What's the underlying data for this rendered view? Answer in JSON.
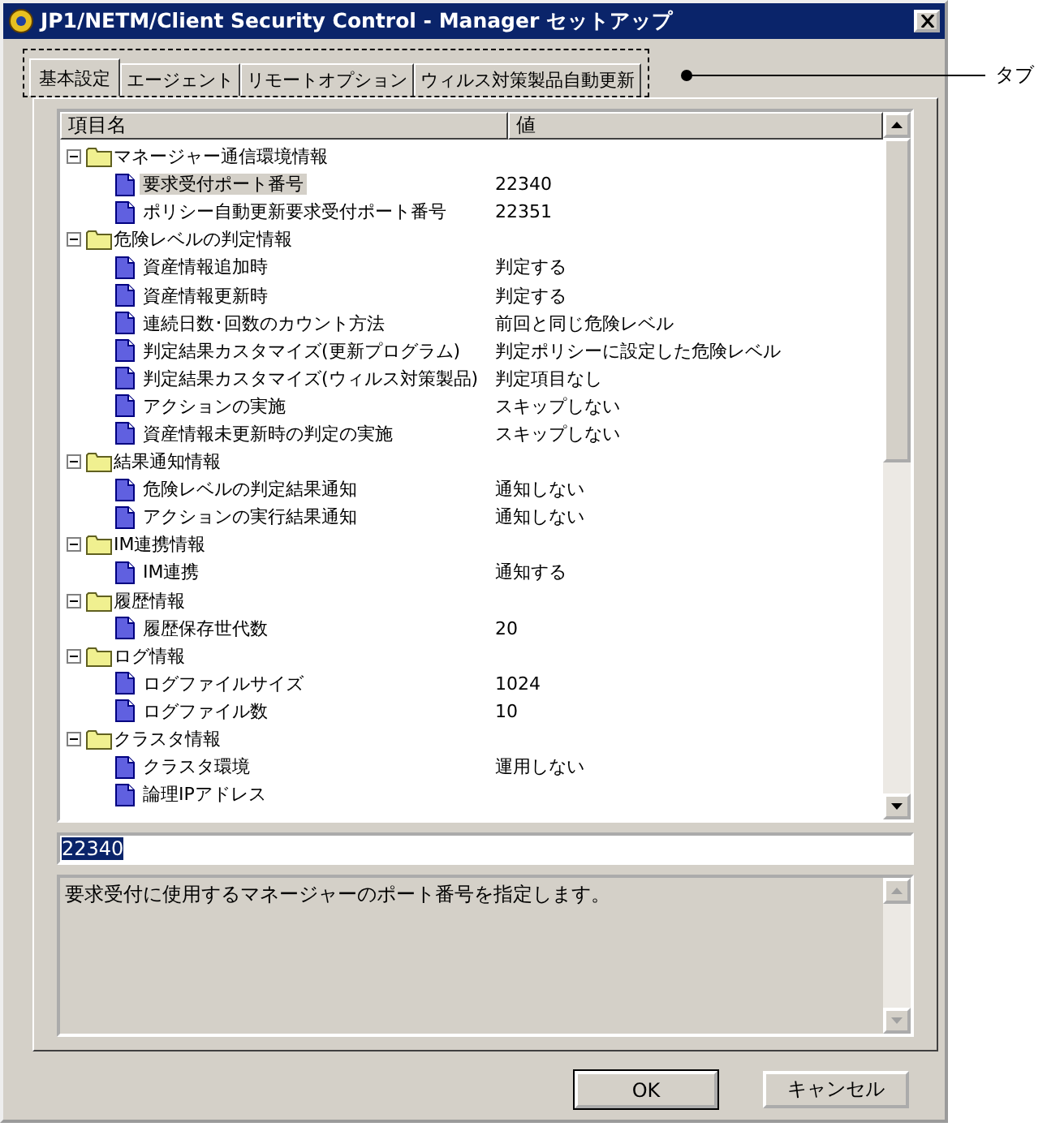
{
  "window": {
    "title": "JP1/NETM/Client Security Control - Manager セットアップ"
  },
  "tabs": [
    {
      "label": "基本設定",
      "selected": true
    },
    {
      "label": "エージェント",
      "selected": false
    },
    {
      "label": "リモートオプション",
      "selected": false
    },
    {
      "label": "ウィルス対策製品自動更新",
      "selected": false
    }
  ],
  "annotation": {
    "label": "タブ"
  },
  "tree": {
    "columns": [
      "項目名",
      "値"
    ],
    "groups": [
      {
        "label": "マネージャー通信環境情報",
        "expanded": true,
        "children": [
          {
            "label": "要求受付ポート番号",
            "value": "22340",
            "selected": true
          },
          {
            "label": "ポリシー自動更新要求受付ポート番号",
            "value": "22351",
            "selected": false
          }
        ]
      },
      {
        "label": "危険レベルの判定情報",
        "expanded": true,
        "children": [
          {
            "label": "資産情報追加時",
            "value": "判定する",
            "selected": false
          },
          {
            "label": "資産情報更新時",
            "value": "判定する",
            "selected": false
          },
          {
            "label": "連続日数･回数のカウント方法",
            "value": "前回と同じ危険レベル",
            "selected": false
          },
          {
            "label": "判定結果カスタマイズ(更新プログラム)",
            "value": "判定ポリシーに設定した危険レベル",
            "selected": false
          },
          {
            "label": "判定結果カスタマイズ(ウィルス対策製品)",
            "value": "判定項目なし",
            "selected": false
          },
          {
            "label": "アクションの実施",
            "value": "スキップしない",
            "selected": false
          },
          {
            "label": "資産情報未更新時の判定の実施",
            "value": "スキップしない",
            "selected": false
          }
        ]
      },
      {
        "label": "結果通知情報",
        "expanded": true,
        "children": [
          {
            "label": "危険レベルの判定結果通知",
            "value": "通知しない",
            "selected": false
          },
          {
            "label": "アクションの実行結果通知",
            "value": "通知しない",
            "selected": false
          }
        ]
      },
      {
        "label": "IM連携情報",
        "expanded": true,
        "children": [
          {
            "label": "IM連携",
            "value": "通知する",
            "selected": false
          }
        ]
      },
      {
        "label": "履歴情報",
        "expanded": true,
        "children": [
          {
            "label": "履歴保存世代数",
            "value": "20",
            "selected": false
          }
        ]
      },
      {
        "label": "ログ情報",
        "expanded": true,
        "children": [
          {
            "label": "ログファイルサイズ",
            "value": "1024",
            "selected": false
          },
          {
            "label": "ログファイル数",
            "value": "10",
            "selected": false
          }
        ]
      },
      {
        "label": "クラスタ情報",
        "expanded": true,
        "children": [
          {
            "label": "クラスタ環境",
            "value": "運用しない",
            "selected": false
          },
          {
            "label": "論理IPアドレス",
            "selected": false
          }
        ]
      }
    ]
  },
  "value_field": {
    "value": "22340"
  },
  "description": "要求受付に使用するマネージャーのポート番号を指定します。",
  "buttons": [
    {
      "label": "OK",
      "default": true
    },
    {
      "label": "キャンセル",
      "default": false
    }
  ]
}
